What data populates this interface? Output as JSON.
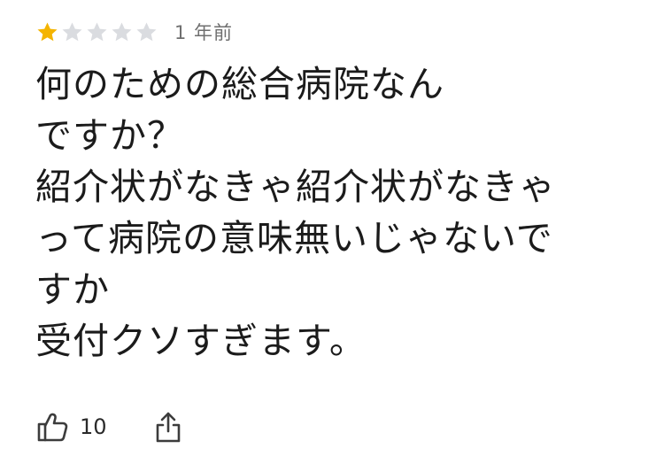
{
  "review": {
    "rating": 1,
    "max_rating": 5,
    "star_color_filled": "#f4b400",
    "star_color_empty": "#dadce0",
    "time_ago": "1 年前",
    "text": "何のための総合病院なん\nですか？\n紹介状がなきゃ紹介状がなきゃ\nって病院の意味無いじゃないで\nすか\n受付クソすぎます。"
  },
  "actions": {
    "like_icon": "thumbs-up-icon",
    "like_count": "10",
    "share_icon": "share-icon"
  }
}
